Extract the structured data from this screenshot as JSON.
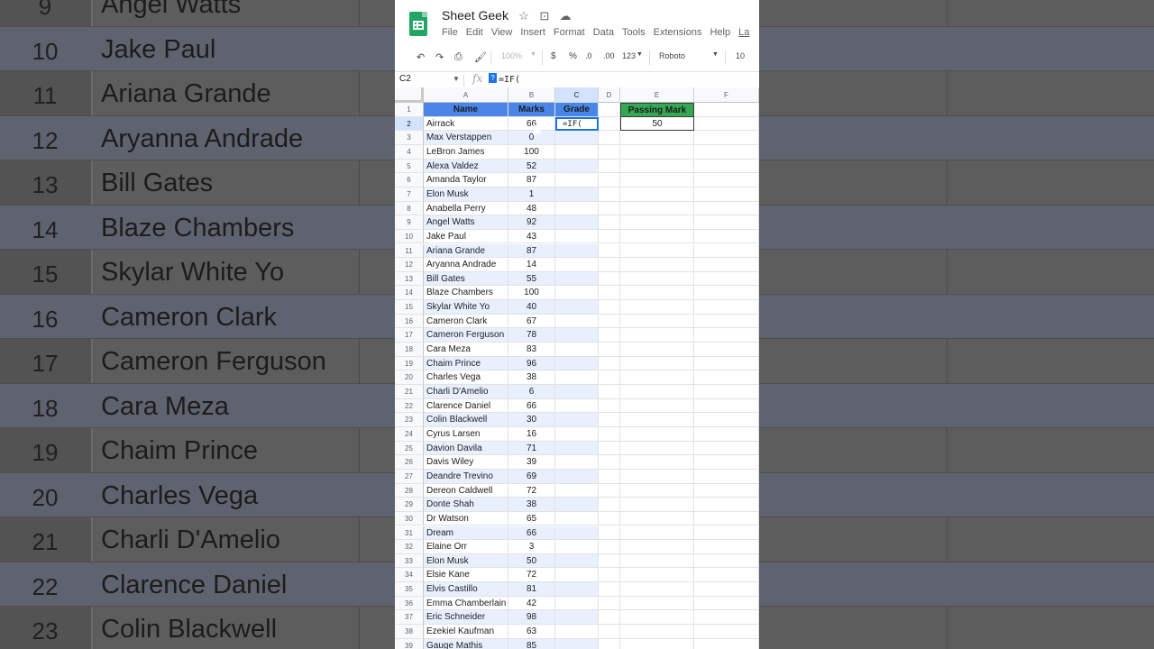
{
  "background": {
    "rows": [
      {
        "num": "9",
        "name": "Angel Watts"
      },
      {
        "num": "10",
        "name": "Jake Paul"
      },
      {
        "num": "11",
        "name": "Ariana Grande"
      },
      {
        "num": "12",
        "name": "Aryanna Andrade"
      },
      {
        "num": "13",
        "name": "Bill Gates"
      },
      {
        "num": "14",
        "name": "Blaze Chambers"
      },
      {
        "num": "15",
        "name": "Skylar White Yo"
      },
      {
        "num": "16",
        "name": "Cameron Clark"
      },
      {
        "num": "17",
        "name": "Cameron Ferguson"
      },
      {
        "num": "18",
        "name": "Cara Meza"
      },
      {
        "num": "19",
        "name": "Chaim Prince"
      },
      {
        "num": "20",
        "name": "Charles Vega"
      },
      {
        "num": "21",
        "name": "Charli D'Amelio"
      },
      {
        "num": "22",
        "name": "Clarence Daniel"
      },
      {
        "num": "23",
        "name": "Colin Blackwell"
      }
    ]
  },
  "app": {
    "title": "Sheet Geek",
    "title_icons": [
      "star-icon",
      "move-folder-icon",
      "cloud-icon"
    ],
    "menu": [
      "File",
      "Edit",
      "View",
      "Insert",
      "Format",
      "Data",
      "Tools",
      "Extensions",
      "Help",
      "La"
    ]
  },
  "toolbar": {
    "zoom": "100%",
    "currency": "$",
    "percent": "%",
    "dec_less": ".0",
    "dec_more": ".00",
    "number_format": "123",
    "font": "Roboto",
    "font_size": "10"
  },
  "formula_bar": {
    "name_box": "C2",
    "fx": "fx",
    "help": "?",
    "formula": "=IF("
  },
  "columns": [
    "A",
    "B",
    "C",
    "D",
    "E",
    "F"
  ],
  "sheet": {
    "headers": {
      "name": "Name",
      "marks": "Marks",
      "grade": "Grade"
    },
    "passing_mark_label": "Passing Mark",
    "passing_mark_value": "50",
    "active_cell_text": "=IF(",
    "rows": [
      {
        "n": "2",
        "name": "Airrack",
        "marks": "66"
      },
      {
        "n": "3",
        "name": "Max Verstappen",
        "marks": "0"
      },
      {
        "n": "4",
        "name": "LeBron James",
        "marks": "100"
      },
      {
        "n": "5",
        "name": "Alexa Valdez",
        "marks": "52"
      },
      {
        "n": "6",
        "name": "Amanda Taylor",
        "marks": "87"
      },
      {
        "n": "7",
        "name": "Elon Musk",
        "marks": "1"
      },
      {
        "n": "8",
        "name": "Anabella Perry",
        "marks": "48"
      },
      {
        "n": "9",
        "name": "Angel Watts",
        "marks": "92"
      },
      {
        "n": "10",
        "name": "Jake Paul",
        "marks": "43"
      },
      {
        "n": "11",
        "name": "Ariana Grande",
        "marks": "87"
      },
      {
        "n": "12",
        "name": "Aryanna Andrade",
        "marks": "14"
      },
      {
        "n": "13",
        "name": "Bill Gates",
        "marks": "55"
      },
      {
        "n": "14",
        "name": "Blaze Chambers",
        "marks": "100"
      },
      {
        "n": "15",
        "name": "Skylar White Yo",
        "marks": "40"
      },
      {
        "n": "16",
        "name": "Cameron Clark",
        "marks": "67"
      },
      {
        "n": "17",
        "name": "Cameron Ferguson",
        "marks": "78"
      },
      {
        "n": "18",
        "name": "Cara Meza",
        "marks": "83"
      },
      {
        "n": "19",
        "name": "Chaim Prince",
        "marks": "96"
      },
      {
        "n": "20",
        "name": "Charles Vega",
        "marks": "38"
      },
      {
        "n": "21",
        "name": "Charli D'Amelio",
        "marks": "6"
      },
      {
        "n": "22",
        "name": "Clarence Daniel",
        "marks": "66"
      },
      {
        "n": "23",
        "name": "Colin Blackwell",
        "marks": "30"
      },
      {
        "n": "24",
        "name": "Cyrus Larsen",
        "marks": "16"
      },
      {
        "n": "25",
        "name": "Davion Davila",
        "marks": "71"
      },
      {
        "n": "26",
        "name": "Davis Wiley",
        "marks": "39"
      },
      {
        "n": "27",
        "name": "Deandre Trevino",
        "marks": "69"
      },
      {
        "n": "28",
        "name": "Dereon Caldwell",
        "marks": "72"
      },
      {
        "n": "29",
        "name": "Donte Shah",
        "marks": "38"
      },
      {
        "n": "30",
        "name": "Dr Watson",
        "marks": "65"
      },
      {
        "n": "31",
        "name": "Dream",
        "marks": "66"
      },
      {
        "n": "32",
        "name": "Elaine Orr",
        "marks": "3"
      },
      {
        "n": "33",
        "name": "Elon Musk",
        "marks": "50"
      },
      {
        "n": "34",
        "name": "Elsie Kane",
        "marks": "72"
      },
      {
        "n": "35",
        "name": "Elvis Castillo",
        "marks": "81"
      },
      {
        "n": "36",
        "name": "Emma Chamberlain",
        "marks": "42"
      },
      {
        "n": "37",
        "name": "Eric Schneider",
        "marks": "98"
      },
      {
        "n": "38",
        "name": "Ezekiel Kaufman",
        "marks": "63"
      },
      {
        "n": "39",
        "name": "Gauge Mathis",
        "marks": "85"
      }
    ]
  }
}
